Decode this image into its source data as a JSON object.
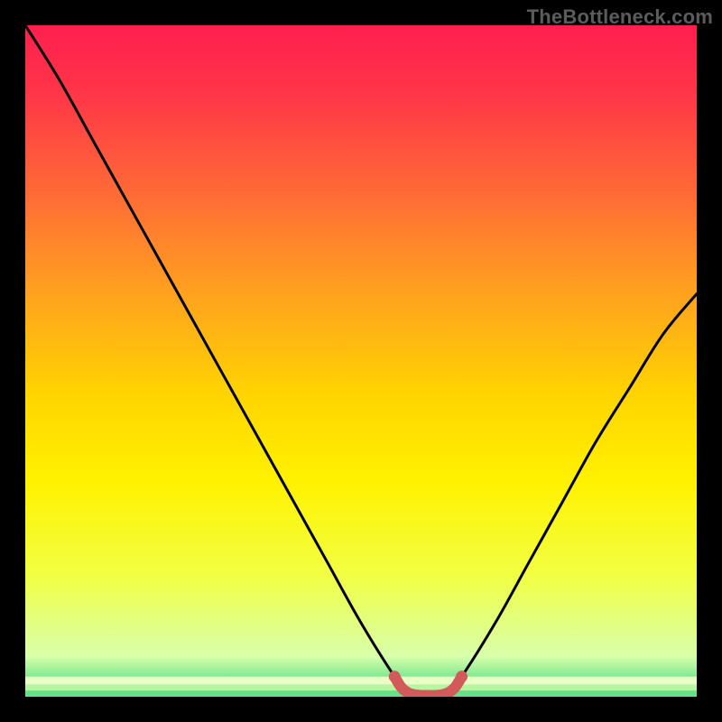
{
  "watermark": "TheBottleneck.com",
  "chart_data": {
    "type": "line",
    "title": "",
    "xlabel": "",
    "ylabel": "",
    "xlim": [
      0,
      100
    ],
    "ylim": [
      0,
      100
    ],
    "grid": false,
    "legend": false,
    "series": [
      {
        "name": "curve",
        "color": "#000000",
        "x": [
          0,
          5,
          10,
          15,
          20,
          25,
          30,
          35,
          40,
          45,
          50,
          55,
          57,
          60,
          63,
          65,
          70,
          75,
          80,
          85,
          90,
          95,
          100
        ],
        "values": [
          100,
          92,
          83,
          74,
          65,
          56,
          47,
          38,
          29,
          20,
          11,
          3,
          0.6,
          0.2,
          0.6,
          3,
          11,
          20,
          29,
          38,
          46,
          54,
          60
        ]
      },
      {
        "name": "min-band",
        "color": "#d25a5a",
        "x": [
          55,
          56,
          57,
          58,
          59,
          60,
          61,
          62,
          63,
          64,
          65
        ],
        "values": [
          3,
          1.4,
          0.6,
          0.3,
          0.2,
          0.2,
          0.2,
          0.3,
          0.6,
          1.4,
          3
        ]
      }
    ],
    "gradient_stops": [
      {
        "offset": 0.0,
        "color": "#ff1f4f"
      },
      {
        "offset": 0.1,
        "color": "#ff3548"
      },
      {
        "offset": 0.25,
        "color": "#ff6a36"
      },
      {
        "offset": 0.4,
        "color": "#ffa21e"
      },
      {
        "offset": 0.55,
        "color": "#ffd400"
      },
      {
        "offset": 0.68,
        "color": "#fff200"
      },
      {
        "offset": 0.82,
        "color": "#f1ff44"
      },
      {
        "offset": 0.94,
        "color": "#d8ffab"
      },
      {
        "offset": 1.0,
        "color": "#2bd47a"
      }
    ],
    "bottom_stripes": [
      {
        "y": 97.0,
        "h": 1.2,
        "color": "#e8ffc6"
      },
      {
        "y": 98.2,
        "h": 0.9,
        "color": "#b8f5a0"
      },
      {
        "y": 99.1,
        "h": 0.9,
        "color": "#67e08a"
      }
    ]
  }
}
